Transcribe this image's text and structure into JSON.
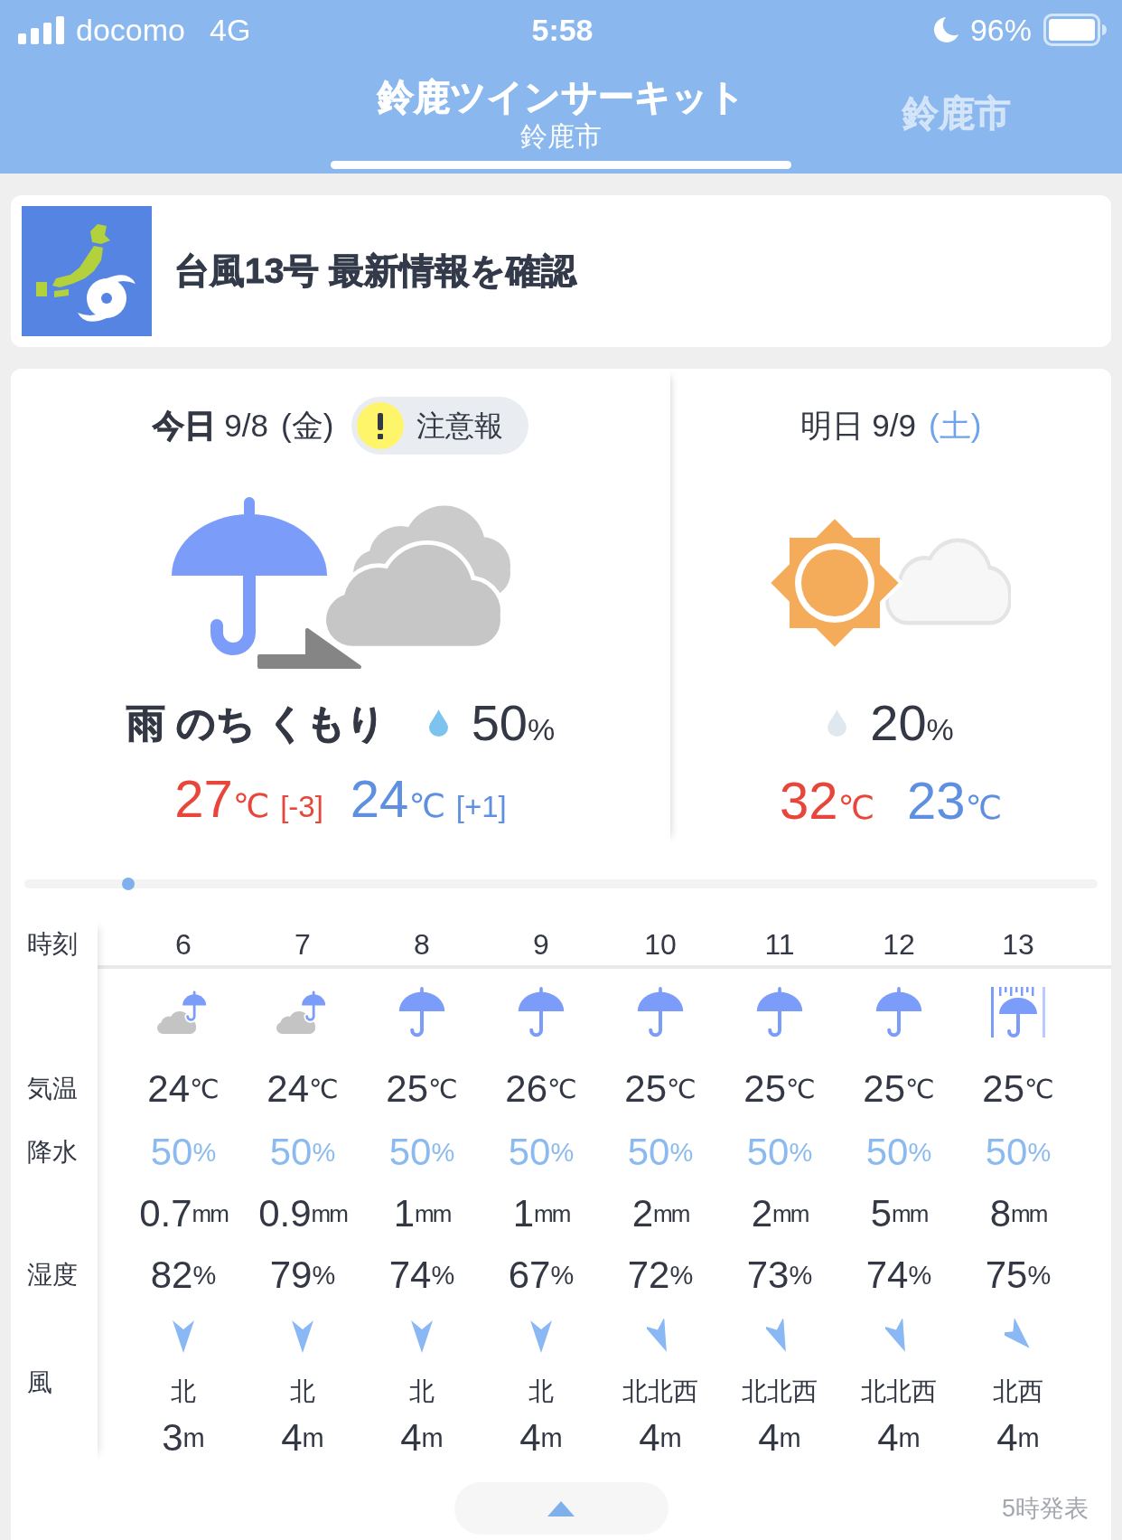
{
  "status_bar": {
    "carrier": "docomo",
    "network": "4G",
    "time": "5:58",
    "battery": "96%"
  },
  "tabs": [
    {
      "title": "鈴鹿ツインサーキット",
      "subtitle": "鈴鹿市",
      "selected": true
    },
    {
      "title": "鈴鹿市",
      "selected": false
    }
  ],
  "banner": {
    "text": "台風13号 最新情報を確認"
  },
  "days": [
    {
      "date": "**今日** 9/8",
      "weekday": {
        "text": "(金)",
        "color": "#333844"
      },
      "badge": {
        "text": "注意報"
      },
      "kind": "rain_then_cloudy",
      "weather": "雨 のち くもり",
      "precipitation": {
        "value": "50",
        "unit": "%",
        "color": "#7cc3ef"
      },
      "high": {
        "value": "27",
        "unit": "℃",
        "diff": "[-3]"
      },
      "low": {
        "value": "24",
        "unit": "℃",
        "diff": "[+1]"
      }
    },
    {
      "date": "明日 9/9",
      "weekday": {
        "text": "(土)",
        "color": "#6fa3ec"
      },
      "kind": "sunny_then_cloudy",
      "precipitation": {
        "value": "20",
        "unit": "%",
        "color": "#dfe7ef"
      },
      "high": {
        "value": "32",
        "unit": "℃"
      },
      "low": {
        "value": "23",
        "unit": "℃"
      }
    }
  ],
  "hourly": {
    "hours": {
      "label": "時刻",
      "cells": [
        "6",
        "7",
        "8",
        "9",
        "10",
        "11",
        "12",
        "13"
      ]
    },
    "icons": [
      {
        "kind": "cloud_umbrella"
      },
      {
        "kind": "cloud_umbrella"
      },
      {
        "kind": "umbrella"
      },
      {
        "kind": "umbrella"
      },
      {
        "kind": "umbrella"
      },
      {
        "kind": "umbrella"
      },
      {
        "kind": "umbrella"
      },
      {
        "kind": "umbrella_heavy"
      }
    ],
    "temperature": {
      "label": "気温",
      "cells": [
        {
          "value": "24",
          "unit": "℃"
        },
        {
          "value": "24",
          "unit": "℃"
        },
        {
          "value": "25",
          "unit": "℃"
        },
        {
          "value": "26",
          "unit": "℃"
        },
        {
          "value": "25",
          "unit": "℃"
        },
        {
          "value": "25",
          "unit": "℃"
        },
        {
          "value": "25",
          "unit": "℃"
        },
        {
          "value": "25",
          "unit": "℃"
        }
      ]
    },
    "precipitation": {
      "label": "降水",
      "cells": [
        {
          "value": "50",
          "unit": "%"
        },
        {
          "value": "50",
          "unit": "%"
        },
        {
          "value": "50",
          "unit": "%"
        },
        {
          "value": "50",
          "unit": "%"
        },
        {
          "value": "50",
          "unit": "%"
        },
        {
          "value": "50",
          "unit": "%"
        },
        {
          "value": "50",
          "unit": "%"
        },
        {
          "value": "50",
          "unit": "%"
        }
      ]
    },
    "amount": {
      "cells": [
        {
          "value": "0.7",
          "unit": "mm"
        },
        {
          "value": "0.9",
          "unit": "mm"
        },
        {
          "value": "1",
          "unit": "mm"
        },
        {
          "value": "1",
          "unit": "mm"
        },
        {
          "value": "2",
          "unit": "mm"
        },
        {
          "value": "2",
          "unit": "mm"
        },
        {
          "value": "5",
          "unit": "mm"
        },
        {
          "value": "8",
          "unit": "mm"
        }
      ]
    },
    "humidity": {
      "label": "湿度",
      "cells": [
        {
          "value": "82",
          "unit": "%"
        },
        {
          "value": "79",
          "unit": "%"
        },
        {
          "value": "74",
          "unit": "%"
        },
        {
          "value": "67",
          "unit": "%"
        },
        {
          "value": "72",
          "unit": "%"
        },
        {
          "value": "73",
          "unit": "%"
        },
        {
          "value": "74",
          "unit": "%"
        },
        {
          "value": "75",
          "unit": "%"
        }
      ]
    },
    "wind": {
      "label": "風",
      "cells": [
        {
          "kind": "N",
          "direction": "北",
          "value": "3",
          "unit": "m"
        },
        {
          "kind": "N",
          "direction": "北",
          "value": "4",
          "unit": "m"
        },
        {
          "kind": "N",
          "direction": "北",
          "value": "4",
          "unit": "m"
        },
        {
          "kind": "N",
          "direction": "北",
          "value": "4",
          "unit": "m"
        },
        {
          "kind": "NNW",
          "direction": "北北西",
          "value": "4",
          "unit": "m"
        },
        {
          "kind": "NNW",
          "direction": "北北西",
          "value": "4",
          "unit": "m"
        },
        {
          "kind": "NNW",
          "direction": "北北西",
          "value": "4",
          "unit": "m"
        },
        {
          "kind": "NW",
          "direction": "北西",
          "value": "4",
          "unit": "m"
        }
      ]
    }
  },
  "footer": {
    "issued": "5時発表"
  }
}
